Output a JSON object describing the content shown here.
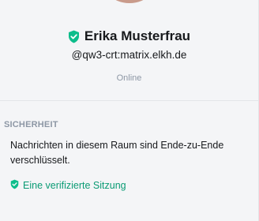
{
  "profile": {
    "display_name": "Erika Musterfrau",
    "user_id": "@qw3-crt:matrix.elkh.de",
    "presence": "Online"
  },
  "security": {
    "section_title": "SICHERHEIT",
    "encryption_text": "Nachrichten in diesem Raum sind Ende-zu-Ende verschlüsselt.",
    "sessions_link": "Eine verifizierte Sitzung"
  },
  "colors": {
    "accent": "#0dbd8b",
    "muted": "#8d97a5",
    "background": "#f4f5f7"
  },
  "icons": {
    "verified": "verified-shield-icon",
    "session": "verified-shield-icon"
  }
}
